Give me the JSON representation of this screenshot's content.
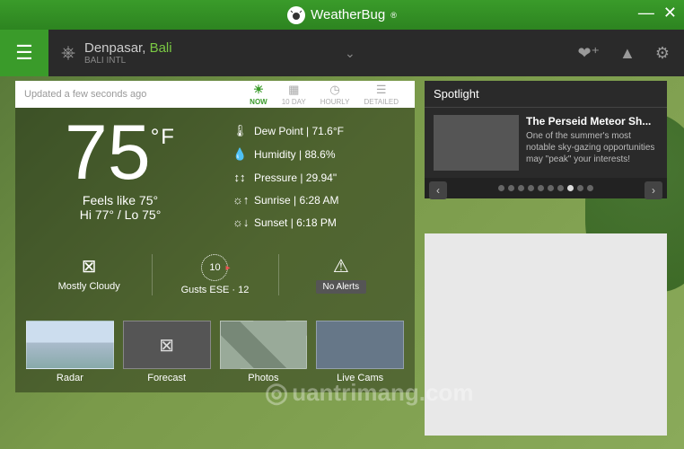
{
  "app": {
    "name": "WeatherBug",
    "trademark": "®"
  },
  "location": {
    "city_prefix": "Denpasar,",
    "city_hl": "Bali",
    "sub": "BALI INTL"
  },
  "header": {
    "updated": "Updated a few seconds ago",
    "tabs": {
      "now": "NOW",
      "tenday": "10 DAY",
      "hourly": "HOURLY",
      "detailed": "DETAILED"
    }
  },
  "current": {
    "temp": "75",
    "unit": "°F",
    "feels_like": "Feels like 75°",
    "hilo": "Hi 77° / Lo 75°"
  },
  "details": {
    "dewpoint_label": "Dew Point  |  71.6°F",
    "humidity_label": "Humidity  |  88.6%",
    "pressure_label": "Pressure  |  29.94\"",
    "sunrise_label": "Sunrise  |  6:28 AM",
    "sunset_label": "Sunset  |  6:18 PM"
  },
  "mid": {
    "condition": "Mostly Cloudy",
    "wind": "Gusts ESE · 12",
    "wind_dial": "10",
    "alerts": "No Alerts"
  },
  "thumbs": {
    "radar": "Radar",
    "forecast": "Forecast",
    "photos": "Photos",
    "livecams": "Live Cams"
  },
  "spotlight": {
    "heading": "Spotlight",
    "title": "The Perseid Meteor Sh...",
    "desc": "One of the summer's most notable sky-gazing opportunities may \"peak\" your interests!"
  },
  "watermark": "uantrimang.com"
}
